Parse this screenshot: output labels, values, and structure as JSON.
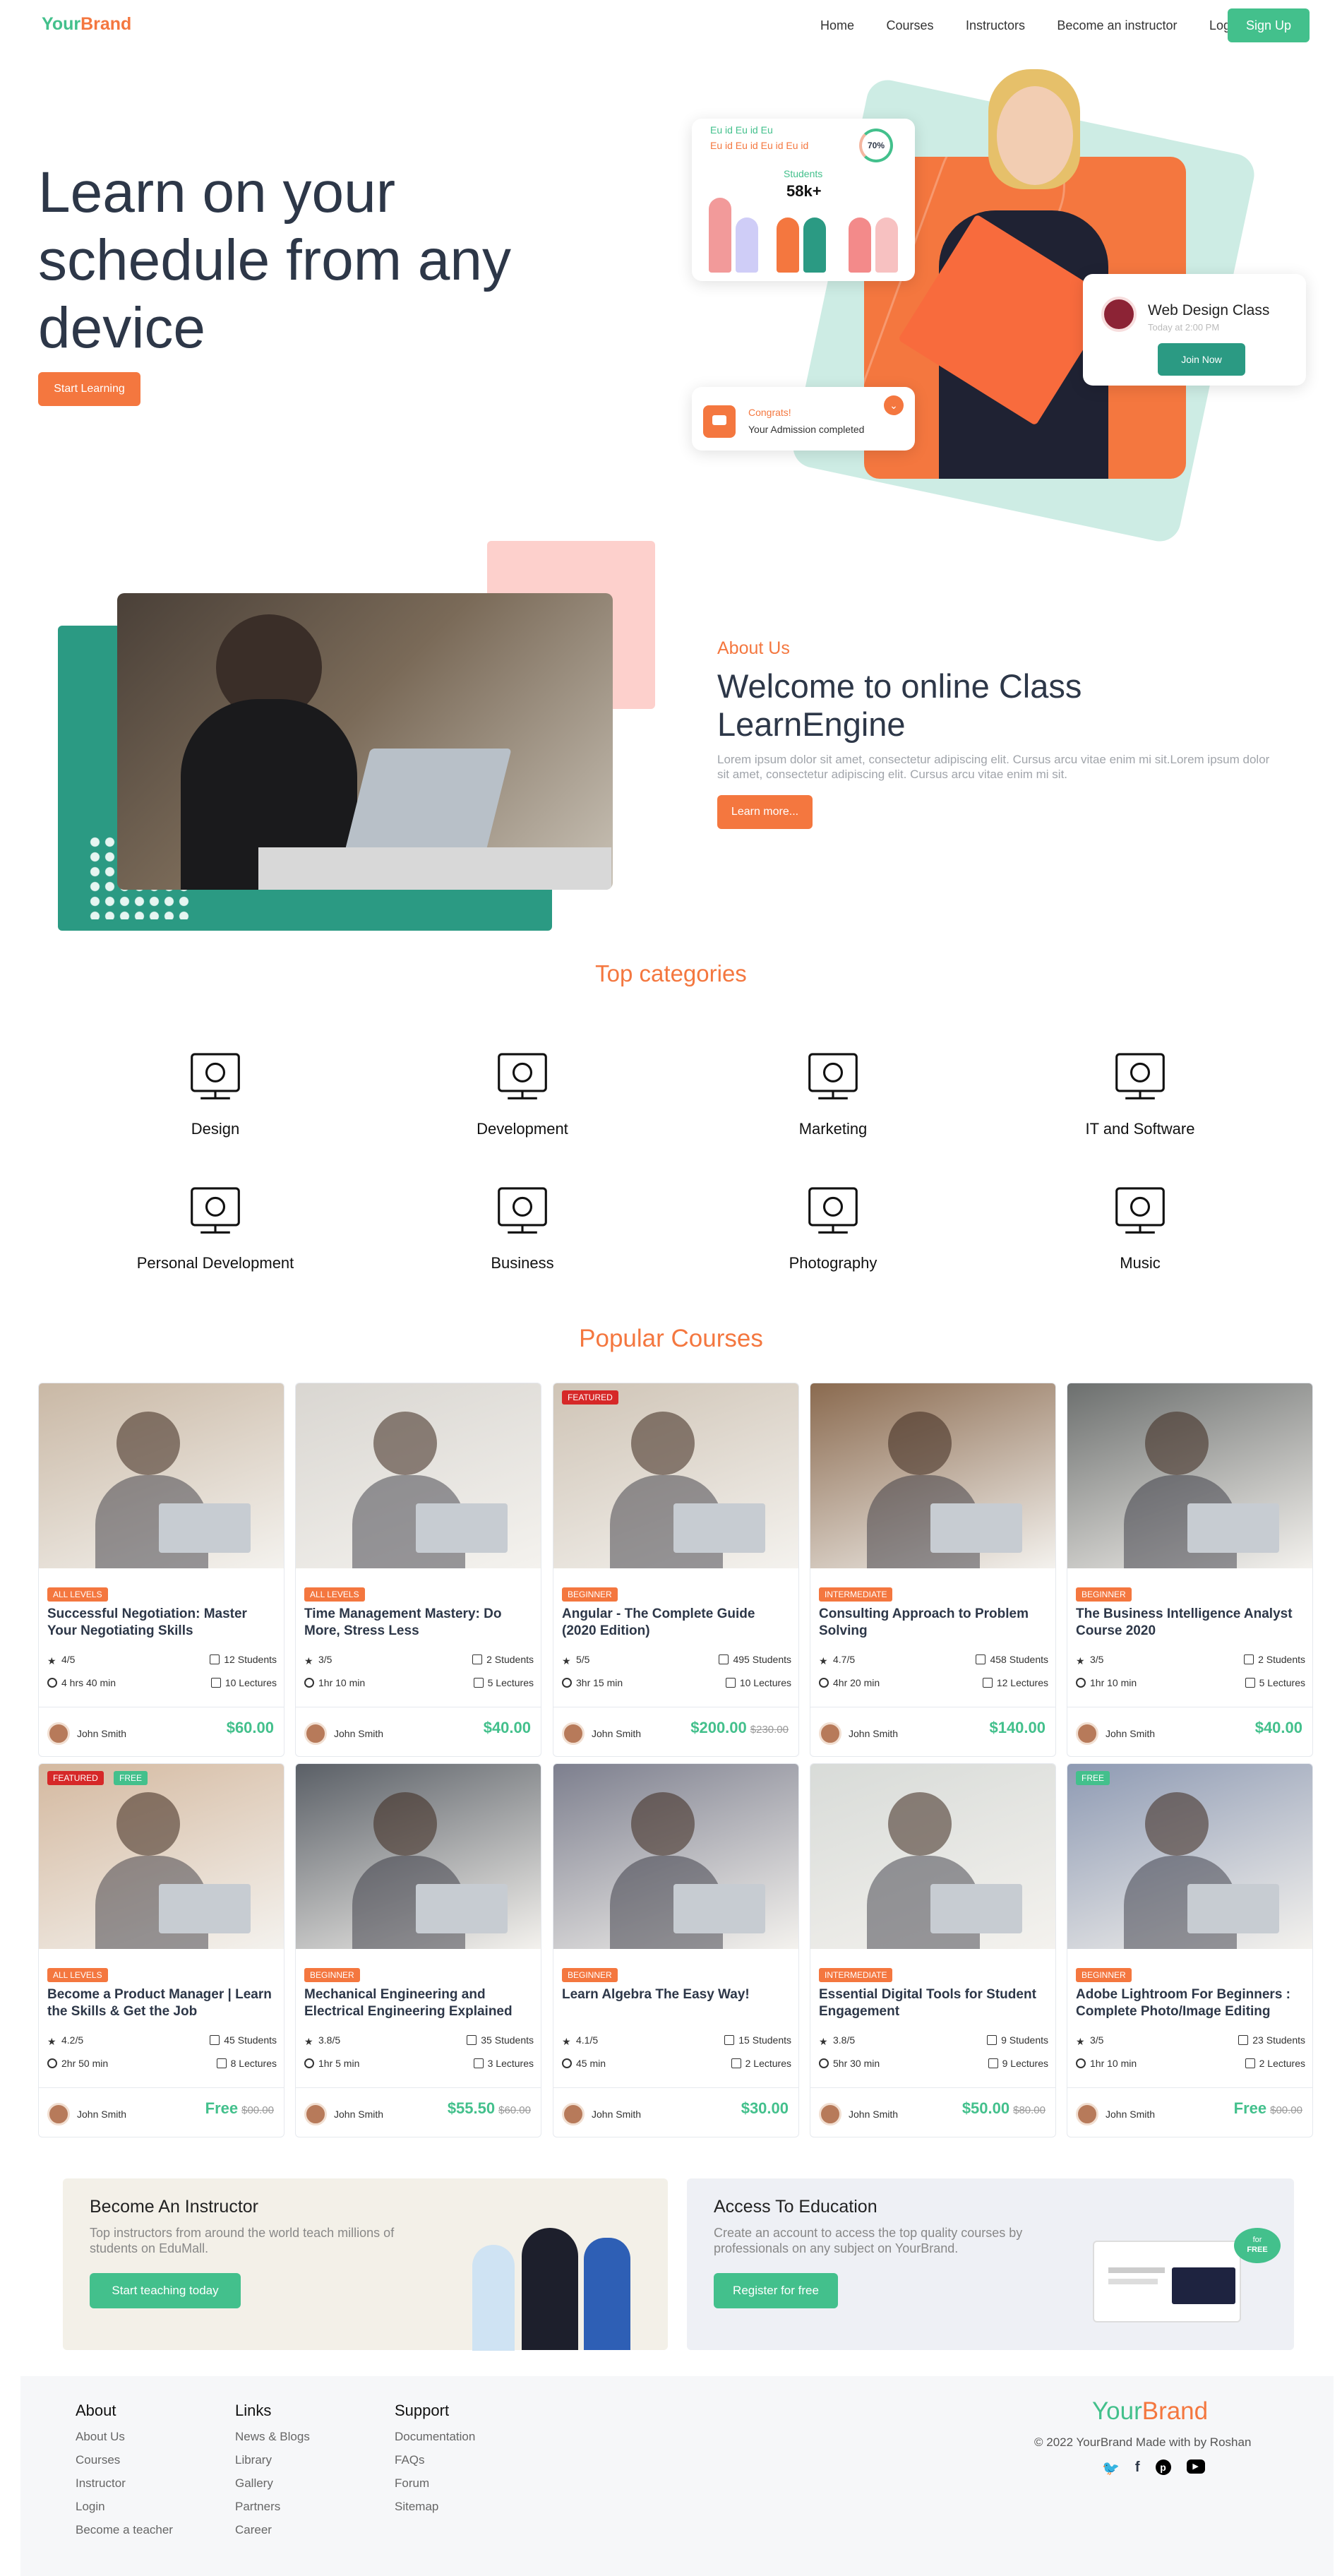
{
  "brand": {
    "part1": "Your",
    "part2": "Brand"
  },
  "nav": {
    "items": [
      "Home",
      "Courses",
      "Instructors",
      "Become an instructor",
      "Login"
    ],
    "signup": "Sign Up"
  },
  "hero": {
    "title": "Learn on your schedule from any device",
    "cta": "Start Learning",
    "stats_card": {
      "line1": "Eu id Eu id Eu",
      "line2": "Eu id Eu id Eu id Eu id",
      "percent": "70%",
      "label": "Students",
      "value": "58k+"
    },
    "class_card": {
      "title": "Web Design Class",
      "time": "Today at 2:00 PM",
      "button": "Join Now"
    },
    "congrats": {
      "title": "Congrats!",
      "text": "Your Admission completed"
    }
  },
  "about": {
    "eyebrow": "About Us",
    "title": "Welcome to online Class LearnEngine",
    "text": "Lorem ipsum dolor sit amet, consectetur adipiscing elit. Cursus arcu vitae enim mi sit.Lorem ipsum dolor sit amet, consectetur adipiscing elit. Cursus arcu vitae enim mi sit.",
    "button": "Learn more..."
  },
  "categories": {
    "title": "Top categories",
    "items": [
      {
        "label": "Design",
        "icon": "design-icon"
      },
      {
        "label": "Development",
        "icon": "development-icon"
      },
      {
        "label": "Marketing",
        "icon": "marketing-icon"
      },
      {
        "label": "IT and Software",
        "icon": "it-software-icon"
      },
      {
        "label": "Personal Development",
        "icon": "personal-development-icon"
      },
      {
        "label": "Business",
        "icon": "business-icon"
      },
      {
        "label": "Photography",
        "icon": "photography-icon"
      },
      {
        "label": "Music",
        "icon": "music-icon"
      }
    ]
  },
  "courses": {
    "title": "Popular Courses",
    "items": [
      {
        "title": "Successful Negotiation: Master Your Negotiating Skills",
        "level": "ALL LEVELS",
        "rating": "4/5",
        "students": "12 Students",
        "duration": "4 hrs 40 min",
        "lectures": "10 Lectures",
        "author": "John Smith",
        "price": "$60.00",
        "old_price": "",
        "tags": [],
        "photo": "#c9b8a5"
      },
      {
        "title": "Time Management Mastery: Do More, Stress Less",
        "level": "ALL LEVELS",
        "rating": "3/5",
        "students": "2 Students",
        "duration": "1hr 10 min",
        "lectures": "5 Lectures",
        "author": "John Smith",
        "price": "$40.00",
        "old_price": "",
        "tags": [],
        "photo": "#d9d6d1"
      },
      {
        "title": "Angular - The Complete Guide (2020 Edition)",
        "level": "BEGINNER",
        "rating": "5/5",
        "students": "495 Students",
        "duration": "3hr 15 min",
        "lectures": "10 Lectures",
        "author": "John Smith",
        "price": "$200.00",
        "old_price": "$230.00",
        "tags": [
          "FEATURED"
        ],
        "photo": "#cfc4b6"
      },
      {
        "title": "Consulting Approach to Problem Solving",
        "level": "INTERMEDIATE",
        "rating": "4.7/5",
        "students": "458 Students",
        "duration": "4hr 20 min",
        "lectures": "12 Lectures",
        "author": "John Smith",
        "price": "$140.00",
        "old_price": "",
        "tags": [],
        "photo": "#8a6a4f"
      },
      {
        "title": "The Business Intelligence Analyst Course 2020",
        "level": "BEGINNER",
        "rating": "3/5",
        "students": "2 Students",
        "duration": "1hr 10 min",
        "lectures": "5 Lectures",
        "author": "John Smith",
        "price": "$40.00",
        "old_price": "",
        "tags": [],
        "photo": "#6c6f6e"
      },
      {
        "title": "Become a Product Manager | Learn the Skills & Get the Job",
        "level": "ALL LEVELS",
        "rating": "4.2/5",
        "students": "45 Students",
        "duration": "2hr 50 min",
        "lectures": "8 Lectures",
        "author": "John Smith",
        "price": "Free",
        "old_price": "$00.00",
        "tags": [
          "FEATURED",
          "FREE"
        ],
        "photo": "#d4b9a0"
      },
      {
        "title": "Mechanical Engineering and Electrical Engineering Explained",
        "level": "BEGINNER",
        "rating": "3.8/5",
        "students": "35 Students",
        "duration": "1hr 5 min",
        "lectures": "3 Lectures",
        "author": "John Smith",
        "price": "$55.50",
        "old_price": "$60.00",
        "tags": [],
        "photo": "#5a5f66"
      },
      {
        "title": "Learn Algebra The Easy Way!",
        "level": "BEGINNER",
        "rating": "4.1/5",
        "students": "15 Students",
        "duration": "45 min",
        "lectures": "2 Lectures",
        "author": "John Smith",
        "price": "$30.00",
        "old_price": "",
        "tags": [],
        "photo": "#7d7f8e"
      },
      {
        "title": "Essential Digital Tools for Student Engagement",
        "level": "INTERMEDIATE",
        "rating": "3.8/5",
        "students": "9 Students",
        "duration": "5hr 30 min",
        "lectures": "9 Lectures",
        "author": "John Smith",
        "price": "$50.00",
        "old_price": "$80.00",
        "tags": [],
        "photo": "#d8dbd8"
      },
      {
        "title": "Adobe Lightroom For Beginners : Complete Photo/Image Editing",
        "level": "BEGINNER",
        "rating": "3/5",
        "students": "23 Students",
        "duration": "1hr 10 min",
        "lectures": "2 Lectures",
        "author": "John Smith",
        "price": "Free",
        "old_price": "$00.00",
        "tags": [
          "FREE"
        ],
        "photo": "#8e9ab3"
      }
    ]
  },
  "instructor": {
    "title": "Become An Instructor",
    "text": "Top instructors from around the world teach millions of students on EduMall.",
    "button": "Start teaching today"
  },
  "access": {
    "title": "Access To Education",
    "text": "Create an account to access the top quality courses by professionals on any subject on YourBrand.",
    "button": "Register for free",
    "badge1": "for",
    "badge2": "FREE"
  },
  "footer": {
    "cols": [
      {
        "title": "About",
        "links": [
          "About Us",
          "Courses",
          "Instructor",
          "Login",
          "Become a teacher"
        ]
      },
      {
        "title": "Links",
        "links": [
          "News & Blogs",
          "Library",
          "Gallery",
          "Partners",
          "Career"
        ]
      },
      {
        "title": "Support",
        "links": [
          "Documentation",
          "FAQs",
          "Forum",
          "Sitemap"
        ]
      }
    ],
    "copyright": "© 2022 YourBrand Made with by Roshan",
    "social": [
      "twitter-icon",
      "facebook-icon",
      "pinterest-icon",
      "youtube-icon"
    ]
  },
  "colors": {
    "green": "#43c08c",
    "orange": "#f4773f",
    "teal": "#2b9a83",
    "red": "#d62828"
  }
}
